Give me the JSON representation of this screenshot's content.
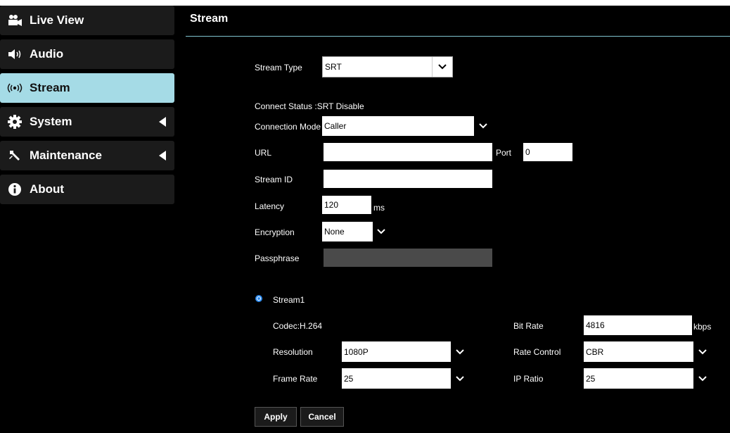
{
  "sidebar": {
    "items": [
      {
        "label": "Live View",
        "icon": "video-camera-icon"
      },
      {
        "label": "Audio",
        "icon": "speaker-icon"
      },
      {
        "label": "Stream",
        "icon": "broadcast-icon",
        "active": true
      },
      {
        "label": "System",
        "icon": "gear-icon"
      },
      {
        "label": "Maintenance",
        "icon": "wrench-icon"
      },
      {
        "label": "About",
        "icon": "info-icon"
      }
    ]
  },
  "main": {
    "title": "Stream",
    "stream_type": {
      "label": "Stream Type",
      "value": "SRT"
    },
    "connect_status": "Connect Status :SRT Disable",
    "connection_mode": {
      "label": "Connection Mode",
      "value": "Caller"
    },
    "url": {
      "label": "URL",
      "value": ""
    },
    "port": {
      "label": "Port",
      "value": "0"
    },
    "stream_id": {
      "label": "Stream ID",
      "value": ""
    },
    "latency": {
      "label": "Latency",
      "value": "120",
      "unit": "ms"
    },
    "encryption": {
      "label": "Encryption",
      "value": "None"
    },
    "passphrase": {
      "label": "Passphrase",
      "value": ""
    },
    "stream1": {
      "label": "Stream1",
      "codec": "Codec:H.264",
      "resolution": {
        "label": "Resolution",
        "value": "1080P"
      },
      "frame_rate": {
        "label": "Frame Rate",
        "value": "25"
      },
      "bit_rate": {
        "label": "Bit Rate",
        "value": "4816",
        "unit": "kbps"
      },
      "rate_control": {
        "label": "Rate Control",
        "value": "CBR"
      },
      "ip_ratio": {
        "label": "IP Ratio",
        "value": "25"
      }
    },
    "buttons": {
      "apply": "Apply",
      "cancel": "Cancel"
    }
  },
  "colors": {
    "accent": "#a5dbe6",
    "radio": "#2d8cf0",
    "rule": "#7fc3cf"
  }
}
